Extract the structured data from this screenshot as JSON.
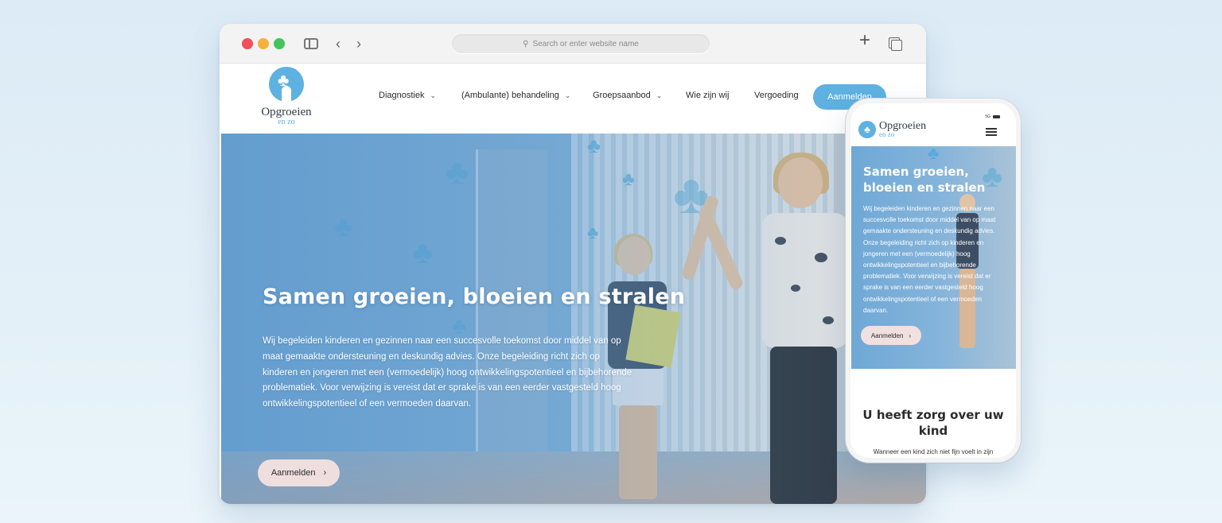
{
  "browser": {
    "address_placeholder": "Search or enter website name",
    "icons": [
      "sidebar-icon",
      "back-icon",
      "forward-icon",
      "search-icon",
      "new-tab-icon",
      "tabs-icon"
    ]
  },
  "site": {
    "logo": {
      "name": "Opgroeien",
      "sub": "en zo"
    },
    "nav": [
      {
        "label": "Diagnostiek",
        "has_dropdown": true
      },
      {
        "label": "(Ambulante) behandeling",
        "has_dropdown": true
      },
      {
        "label": "Groepsaanbod",
        "has_dropdown": true
      },
      {
        "label": "Wie zijn wij",
        "has_dropdown": false
      },
      {
        "label": "Vergoeding",
        "has_dropdown": false
      }
    ],
    "nav_cta": "Aanmelden",
    "hero": {
      "title": "Samen groeien, bloeien en stralen",
      "text": "Wij begeleiden kinderen en gezinnen naar een succesvolle toekomst door middel van op maat gemaakte ondersteuning en deskundig advies. Onze begeleiding richt zich op kinderen en jongeren met een (vermoedelijk) hoog ontwikkelingspotentieel en bijbehorende problematiek. Voor verwijzing is vereist dat er sprake is van een eerder vastgesteld hoog ontwikkelingspotentieel of een vermoeden daarvan.",
      "button": "Aanmelden"
    },
    "colors": {
      "brand": "#5eb1e0",
      "button_bg": "#eedede",
      "text_dark": "#2b2b2b"
    }
  },
  "mobile": {
    "logo": {
      "name": "Opgroeien",
      "sub": "en zo"
    },
    "status": "5G",
    "hero": {
      "title": "Samen groeien, bloeien en stralen",
      "text": "Wij begeleiden kinderen en gezinnen naar een succesvolle toekomst door middel van op maat gemaakte ondersteuning en deskundig advies. Onze begeleiding richt zich op kinderen en jongeren met een (vermoedelijk) hoog ontwikkelingspotentieel en bijbehorende problematiek. Voor verwijzing is vereist dat er sprake is van een eerder vastgesteld hoog ontwikkelingspotentieel of een vermoeden daarvan.",
      "button": "Aanmelden"
    },
    "section_title": "U heeft zorg over uw kind",
    "section_text": "Wanneer een kind zich niet fijn voelt in zijn"
  }
}
